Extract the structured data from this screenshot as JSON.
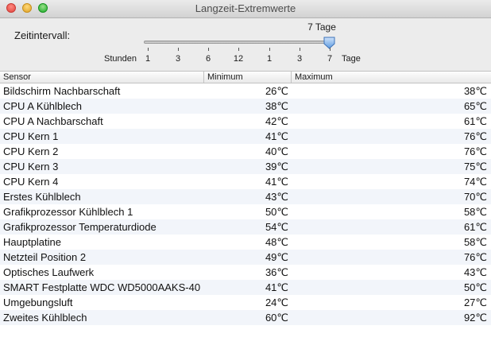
{
  "window": {
    "title": "Langzeit-Extremwerte"
  },
  "controls": {
    "interval_label": "Zeitintervall:",
    "current_value": "7 Tage",
    "unit_left": "Stunden",
    "unit_right": "Tage",
    "ticks": [
      "1",
      "3",
      "6",
      "12",
      "1",
      "3",
      "7"
    ],
    "selected_index": 6
  },
  "table": {
    "columns": [
      "Sensor",
      "Minimum",
      "Maximum"
    ],
    "rows": [
      {
        "sensor": "Bildschirm Nachbarschaft",
        "min": "26℃",
        "max": "38℃"
      },
      {
        "sensor": "CPU A Kühlblech",
        "min": "38℃",
        "max": "65℃"
      },
      {
        "sensor": "CPU A Nachbarschaft",
        "min": "42℃",
        "max": "61℃"
      },
      {
        "sensor": "CPU Kern 1",
        "min": "41℃",
        "max": "76℃"
      },
      {
        "sensor": "CPU Kern 2",
        "min": "40℃",
        "max": "76℃"
      },
      {
        "sensor": "CPU Kern 3",
        "min": "39℃",
        "max": "75℃"
      },
      {
        "sensor": "CPU Kern 4",
        "min": "41℃",
        "max": "74℃"
      },
      {
        "sensor": "Erstes Kühlblech",
        "min": "43℃",
        "max": "70℃"
      },
      {
        "sensor": "Grafikprozessor Kühlblech 1",
        "min": "50℃",
        "max": "58℃"
      },
      {
        "sensor": "Grafikprozessor Temperaturdiode",
        "min": "54℃",
        "max": "61℃"
      },
      {
        "sensor": "Hauptplatine",
        "min": "48℃",
        "max": "58℃"
      },
      {
        "sensor": "Netzteil Position 2",
        "min": "49℃",
        "max": "76℃"
      },
      {
        "sensor": "Optisches Laufwerk",
        "min": "36℃",
        "max": "43℃"
      },
      {
        "sensor": "SMART Festplatte WDC WD5000AAKS-40",
        "min": "41℃",
        "max": "50℃"
      },
      {
        "sensor": "Umgebungsluft",
        "min": "24℃",
        "max": "27℃"
      },
      {
        "sensor": "Zweites Kühlblech",
        "min": "60℃",
        "max": "92℃"
      }
    ]
  }
}
